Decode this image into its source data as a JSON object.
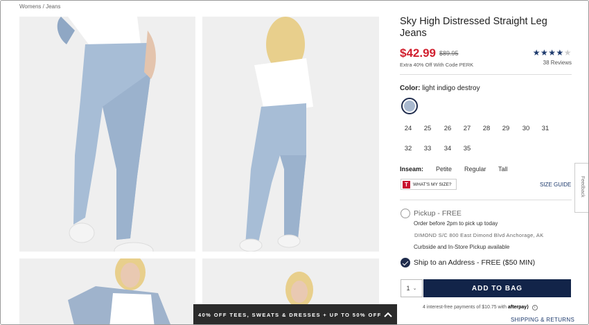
{
  "breadcrumb": {
    "text": "Womens / Jeans"
  },
  "product": {
    "title": "Sky High Distressed Straight Leg Jeans",
    "price": "$42.99",
    "original_price": "$89.95",
    "perk_text": "Extra 40% Off With Code PERK",
    "rating_stars": "★★★★",
    "rating_star_empty": "★",
    "rating_value": 4,
    "reviews": "38 Reviews"
  },
  "color": {
    "label": "Color:",
    "value": "light indigo destroy",
    "swatch_hex": "#a9b9cf"
  },
  "sizes": {
    "row1": [
      "24",
      "25",
      "26",
      "27",
      "28",
      "29",
      "30",
      "31"
    ],
    "row2": [
      "32",
      "33",
      "34",
      "35"
    ]
  },
  "inseam": {
    "label": "Inseam:",
    "options": [
      "Petite",
      "Regular",
      "Tall"
    ]
  },
  "fit": {
    "whats_my_size": "WHAT'S MY SIZE?",
    "t_icon": "T",
    "size_guide": "SIZE GUIDE"
  },
  "feedback": {
    "label": "Feedback"
  },
  "pickup": {
    "title": "Pickup - FREE",
    "subtitle": "Order before 2pm to pick up today",
    "address": "DIMOND S/C 800 East Dimond Blvd Anchorage, AK",
    "availability": "Curbside and In-Store Pickup available"
  },
  "ship": {
    "label": "Ship to an Address - FREE ($50 MIN)"
  },
  "cart": {
    "quantity": "1",
    "add_button": "ADD TO BAG"
  },
  "afterpay": {
    "text": "4 interest-free payments of $10.75 with",
    "brand": "afterpay⟩",
    "info": "i"
  },
  "shipping_link": "SHIPPING & RETURNS",
  "promo": {
    "text": "40% OFF TEES, SWEATS & DRESSES + UP TO 50% OFF"
  },
  "colors": {
    "accent_price": "#d1202f",
    "navy": "#122449",
    "star": "#1d3a6d"
  }
}
